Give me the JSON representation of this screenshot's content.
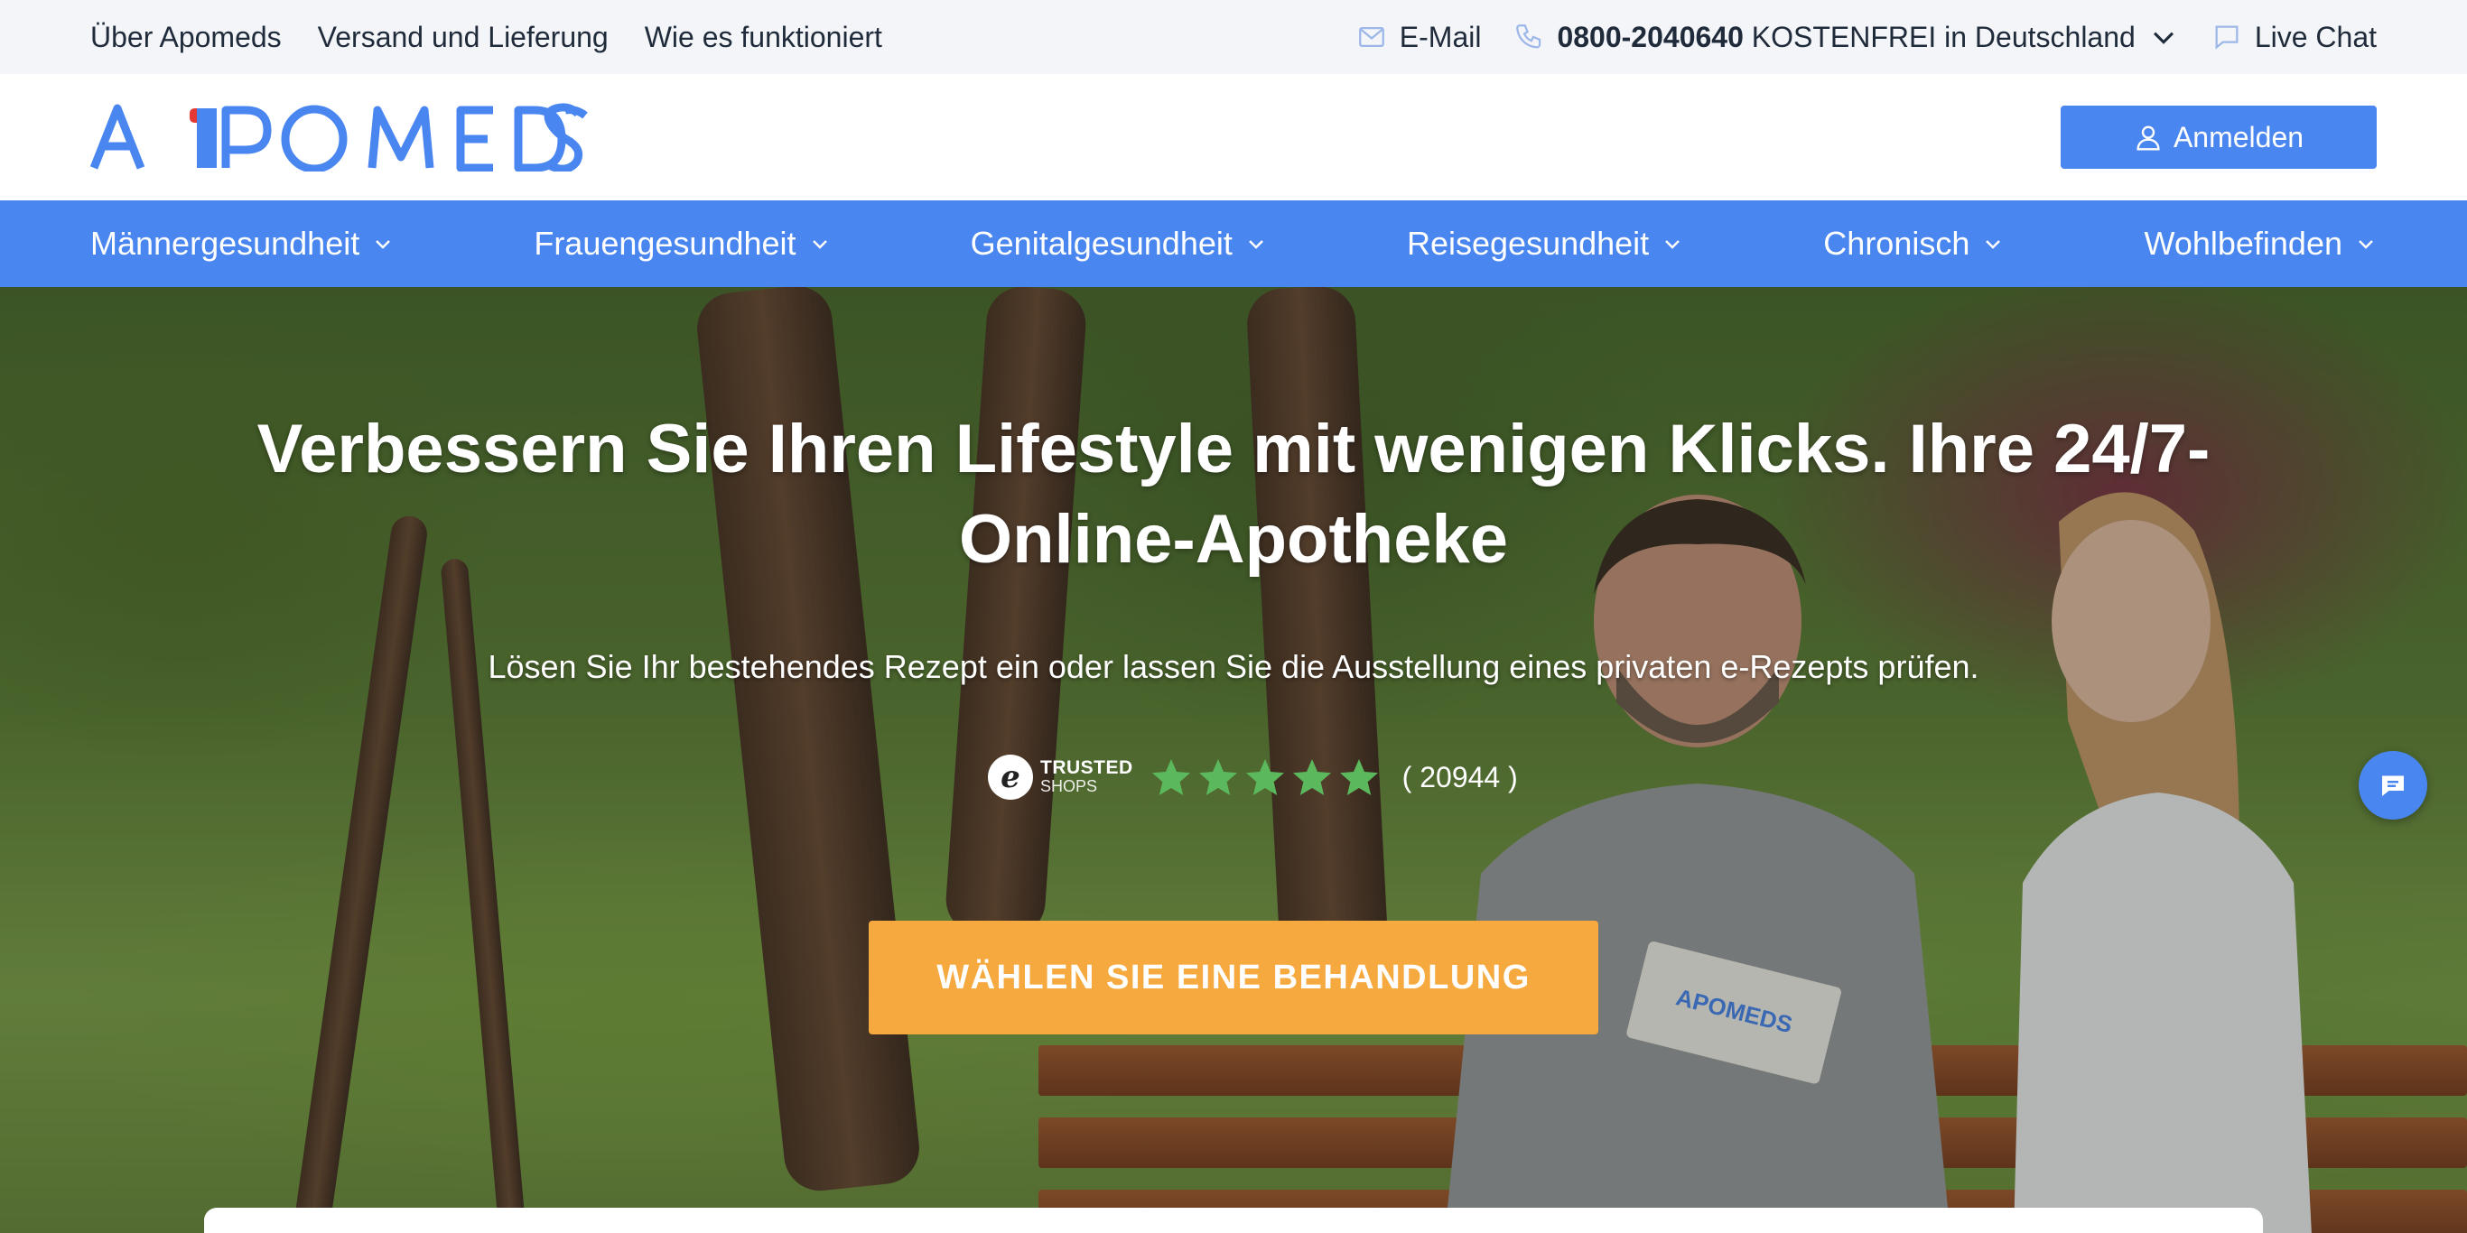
{
  "topbar": {
    "links": [
      "Über Apomeds",
      "Versand und Lieferung",
      "Wie es funktioniert"
    ],
    "email_label": "E-Mail",
    "phone_number": "0800-2040640",
    "phone_note": "KOSTENFREI in Deutschland",
    "live_chat_label": "Live Chat"
  },
  "header": {
    "logo_text": "APOMEDS",
    "login_label": "Anmelden"
  },
  "nav": {
    "items": [
      "Männergesundheit",
      "Frauengesundheit",
      "Genitalgesundheit",
      "Reisegesundheit",
      "Chronisch",
      "Wohlbefinden"
    ]
  },
  "hero": {
    "title": "Verbessern Sie Ihren Lifestyle mit wenigen Klicks. Ihre 24/7-Online-Apotheke",
    "subtitle": "Lösen Sie Ihr bestehendes Rezept ein oder lassen Sie die Ausstellung eines privaten e-Rezepts prüfen.",
    "trusted_line1": "TRUSTED",
    "trusted_line2": "SHOPS",
    "trusted_letter": "e",
    "rating_stars": 5,
    "rating_count": "( 20944 )",
    "cta_label": "WÄHLEN SIE EINE BEHANDLUNG",
    "box_text": "APOMEDS"
  },
  "colors": {
    "primary": "#4a86f0",
    "cta": "#f5a93f",
    "logo_accent": "#e53935",
    "star": "#5cb85c",
    "topbar_bg": "#f3f5f8"
  },
  "icons": [
    "mail-icon",
    "phone-icon",
    "chevron-down-icon",
    "chat-bubble-icon",
    "user-icon",
    "star-icon",
    "chat-fab-icon"
  ]
}
